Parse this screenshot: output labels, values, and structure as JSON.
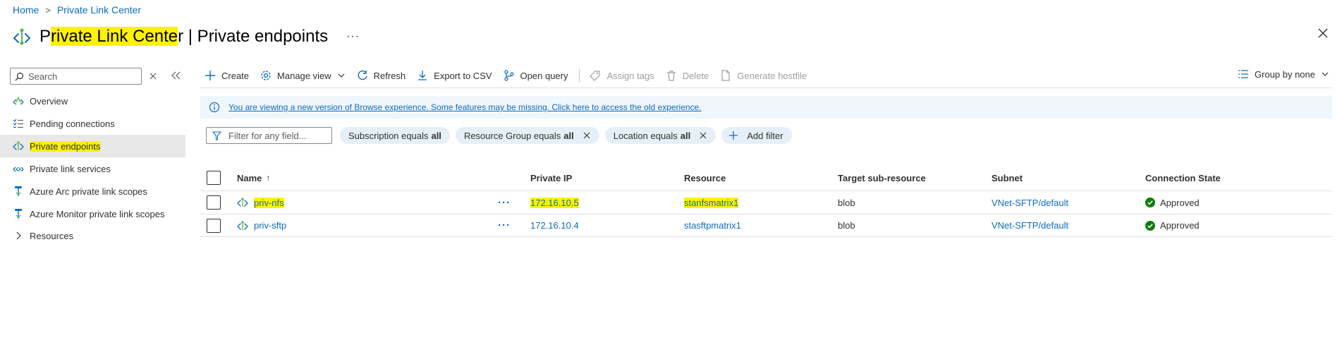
{
  "breadcrumb": {
    "home": "Home",
    "current": "Private Link Center"
  },
  "title": {
    "highlighted_part": "rivate Link Cente",
    "prefix": "P",
    "suffix": "r",
    "rest": " | Private endpoints",
    "more": "···"
  },
  "sidebar": {
    "search_placeholder": "Search",
    "items": [
      {
        "label": "Overview",
        "icon": "overview-icon"
      },
      {
        "label": "Pending connections",
        "icon": "list-icon"
      },
      {
        "label": "Private endpoints",
        "icon": "private-endpoint-icon",
        "active": true
      },
      {
        "label": "Private link services",
        "icon": "link-service-icon"
      },
      {
        "label": "Azure Arc private link scopes",
        "icon": "scope-icon"
      },
      {
        "label": "Azure Monitor private link scopes",
        "icon": "scope-icon"
      },
      {
        "label": "Resources",
        "icon": "chevron-right-icon"
      }
    ]
  },
  "toolbar": {
    "create": "Create",
    "manage_view": "Manage view",
    "refresh": "Refresh",
    "export_csv": "Export to CSV",
    "open_query": "Open query",
    "assign_tags": "Assign tags",
    "delete": "Delete",
    "generate_hostfile": "Generate hostfile",
    "group_by": "Group by none"
  },
  "banner": {
    "text": "You are viewing a new version of Browse experience. Some features may be missing. Click here to access the old experience."
  },
  "filters": {
    "placeholder": "Filter for any field...",
    "pills": [
      {
        "label": "Subscription equals",
        "value": "all"
      },
      {
        "label": "Resource Group equals",
        "value": "all"
      },
      {
        "label": "Location equals",
        "value": "all"
      }
    ],
    "add_filter": "Add filter"
  },
  "table": {
    "columns": [
      "Name",
      "Private IP",
      "Resource",
      "Target sub-resource",
      "Subnet",
      "Connection State"
    ],
    "sort_indicator": "↑",
    "rows": [
      {
        "name": "priv-nfs",
        "ip": "172.16.10.5",
        "resource": "stanfsmatrix1",
        "target": "blob",
        "subnet": "VNet-SFTP/default",
        "state": "Approved",
        "highlighted": true
      },
      {
        "name": "priv-sftp",
        "ip": "172.16.10.4",
        "resource": "stasftpmatrix1",
        "target": "blob",
        "subnet": "VNet-SFTP/default",
        "state": "Approved",
        "highlighted": false
      }
    ],
    "row_more": "···"
  },
  "colors": {
    "accent": "#0f6cbd",
    "highlight": "#fff200",
    "success": "#107c10",
    "banner_bg": "#eff6fc",
    "pill_bg": "#e6eff8"
  }
}
